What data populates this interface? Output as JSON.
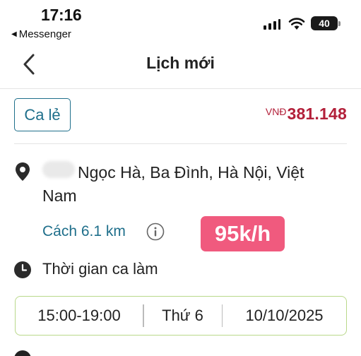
{
  "status_bar": {
    "time": "17:16",
    "back_app": "Messenger",
    "battery": "40"
  },
  "header": {
    "title": "Lịch mới"
  },
  "shift": {
    "type_label": "Ca lẻ",
    "currency": "VNĐ",
    "amount": "381.148",
    "address": "Ngọc Hà, Ba Đình, Hà Nội, Việt Nam",
    "distance": "Cách 6.1 km",
    "rate": "95k/h",
    "time_label": "Thời gian ca làm",
    "time_range": "15:00-19:00",
    "weekday": "Thứ 6",
    "date": "10/10/2025"
  },
  "colors": {
    "accent": "#1f6f8b",
    "price": "#b3203a",
    "rate_badge": "#f05a7e",
    "time_box_border": "#b9d88a"
  },
  "icons": {
    "back": "chevron-left-icon",
    "location": "location-pin-icon",
    "info": "info-icon",
    "clock": "clock-icon"
  }
}
